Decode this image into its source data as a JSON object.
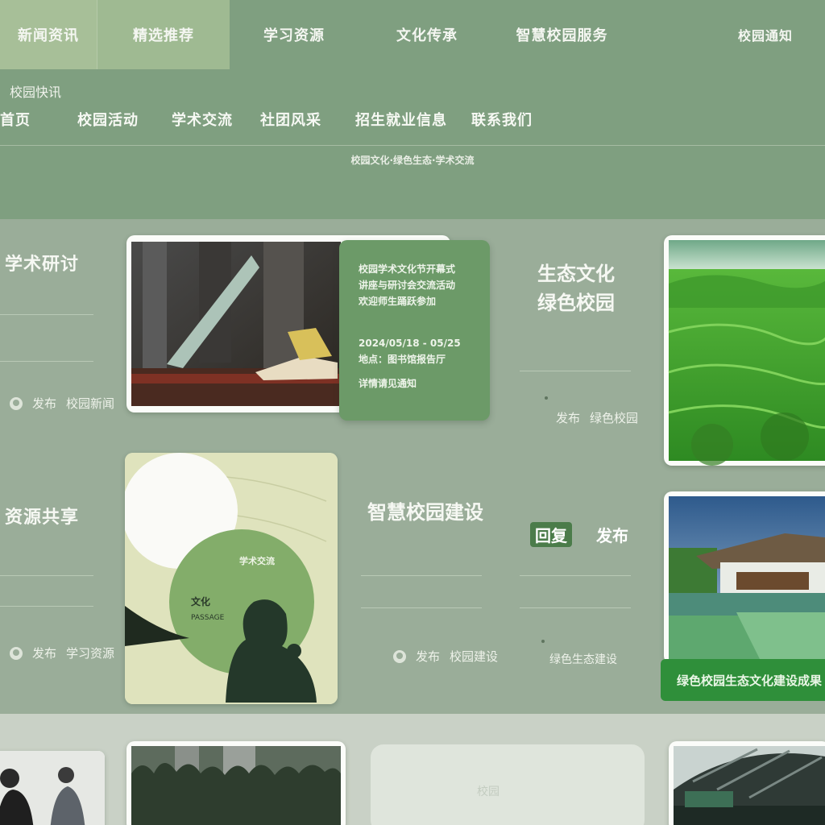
{
  "nav": {
    "tabs": [
      "新闻资讯",
      "精选推荐",
      "学习资源",
      "文化传承",
      "智慧校园服务",
      "校园通知"
    ]
  },
  "subnav": {
    "title": "校园快讯",
    "items": [
      "首页",
      "校园活动",
      "学术交流",
      "社团风采",
      "招生就业信息",
      "联系我们"
    ]
  },
  "header": {
    "caption": "校园文化·绿色生态·学术交流"
  },
  "sections": [
    {
      "side_title": "学术研讨",
      "side_meta": {
        "label": "发布",
        "value": "校园新闻"
      },
      "info_panel": {
        "lines_a": [
          "校园学术文化节开幕式",
          "讲座与研讨会交流活动",
          "欢迎师生踊跃参加"
        ],
        "lines_b": [
          "2024/05/18 - 05/25",
          "地点：图书馆报告厅"
        ],
        "line_c": "详情请见通知"
      },
      "col_title": "生态文化\n绿色校园",
      "col_meta": {
        "label": "发布",
        "value": "绿色校园"
      }
    },
    {
      "side_title": "资源共享",
      "side_meta": {
        "label": "发布",
        "value": "学习资源"
      },
      "poster": {
        "small": "学术交流",
        "caption": "文化",
        "sub": "PASSAGE"
      },
      "col_title": "智慧校园建设",
      "col_meta": {
        "label": "发布",
        "value": "校园建设"
      },
      "badges": [
        "回复",
        "发布"
      ],
      "col3_meta": "绿色生态建设"
    }
  ],
  "green_banner": "绿色校园生态文化建设成果 立",
  "bottom": {
    "blank_card_mark": "校园"
  },
  "colors": {
    "header_bg": "#7f9f80",
    "accent_green": "#6c9a68",
    "banner_green": "#2f8f3a",
    "page_bg": "#9aad99"
  }
}
